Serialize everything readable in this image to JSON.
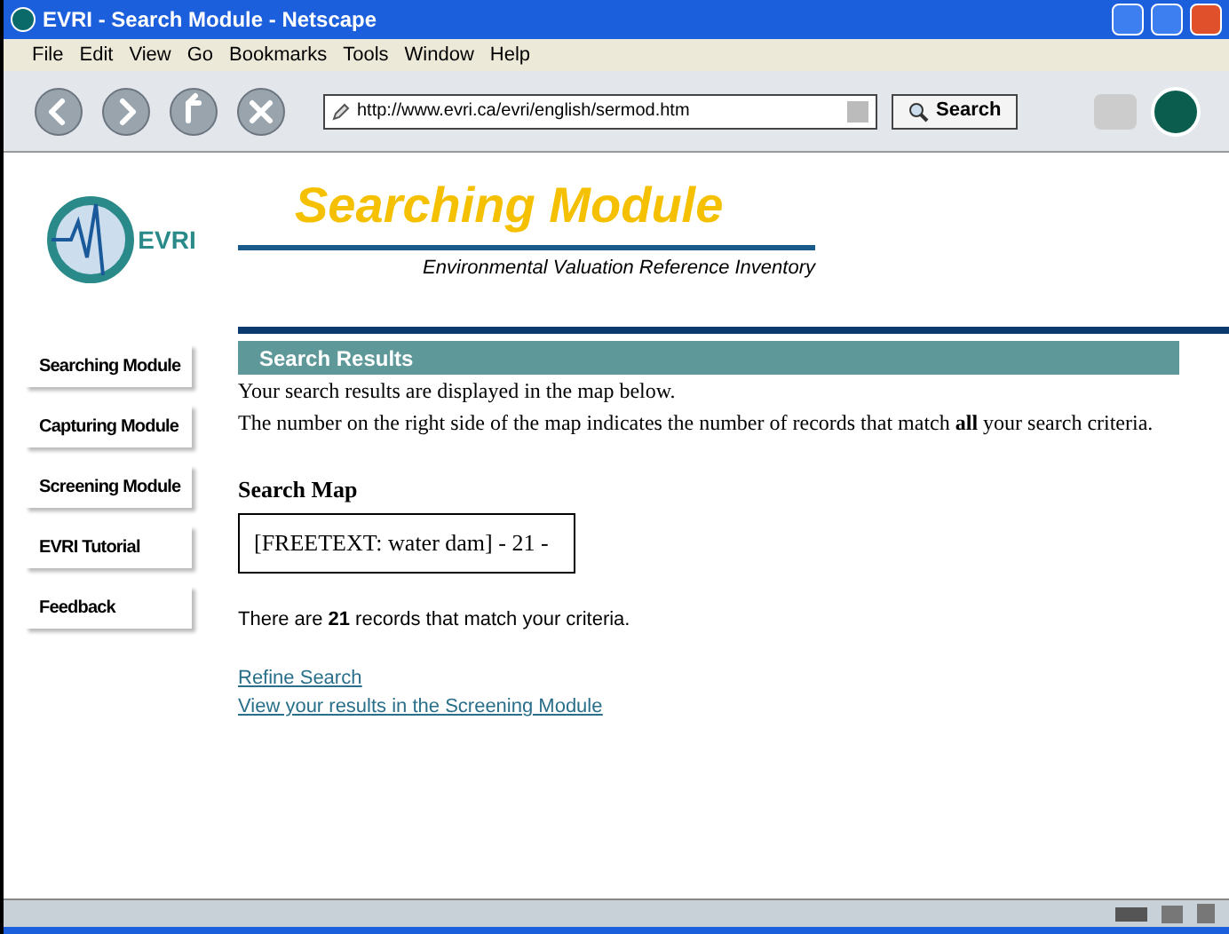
{
  "window": {
    "title": "EVRI - Search Module - Netscape"
  },
  "menu": [
    "File",
    "Edit",
    "View",
    "Go",
    "Bookmarks",
    "Tools",
    "Window",
    "Help"
  ],
  "toolbar": {
    "url": "http://www.evri.ca/evri/english/sermod.htm",
    "search_button": "Search"
  },
  "logo": {
    "text": "EVRI"
  },
  "banner": {
    "title": "Searching Module",
    "subtitle": "Environmental Valuation Reference Inventory"
  },
  "nav": [
    "Searching Module",
    "Capturing Module",
    "Screening Module",
    "EVRI Tutorial",
    "Feedback"
  ],
  "section": {
    "header": "Search Results",
    "paragraphs": [
      "Your search results are displayed in the map below.",
      "The number on the right side of the map indicates the number of records that match **all** your search criteria."
    ],
    "map_heading": "Search Map",
    "map_text": "[FREETEXT: water dam] - 21 -",
    "count_text": "There are **21** records that match your criteria.",
    "links": [
      "Refine Search",
      "View your results in the Screening Module"
    ]
  }
}
